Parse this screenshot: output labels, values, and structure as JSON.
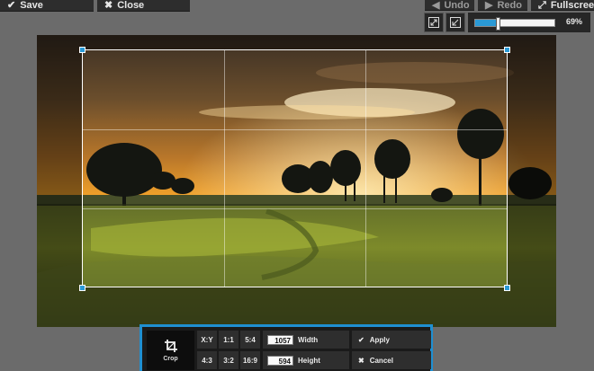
{
  "toolbar": {
    "save_label": "Save",
    "close_label": "Close",
    "undo_label": "Undo",
    "redo_label": "Redo",
    "fullscreen_label": "Fullscreen"
  },
  "zoom": {
    "value_label": "69%",
    "level": 0.28
  },
  "crop_panel": {
    "crop_label": "Crop",
    "ratios_row1": [
      "X:Y",
      "1:1",
      "5:4"
    ],
    "ratios_row2": [
      "4:3",
      "3:2",
      "16:9"
    ],
    "width_value": "1057",
    "width_label": "Width",
    "height_value": "594",
    "height_label": "Height",
    "apply_label": "Apply",
    "cancel_label": "Cancel"
  },
  "colors": {
    "accent": "#2a9ad6",
    "panel_border": "#1f8fd1",
    "toolbar_bg": "#2d2d2d",
    "app_bg": "#6b6b6b"
  },
  "icons": [
    "check-icon",
    "close-icon",
    "undo-icon",
    "redo-icon",
    "fullscreen-icon",
    "zoom-fit-icon",
    "zoom-actual-icon",
    "crop-icon"
  ]
}
